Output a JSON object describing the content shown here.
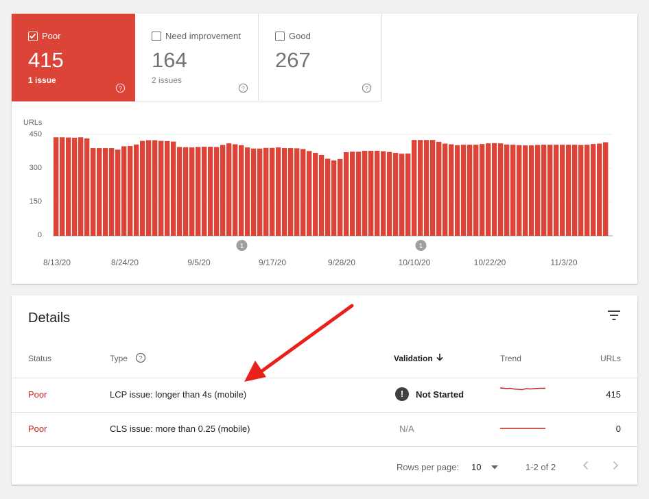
{
  "tiles": [
    {
      "label": "Poor",
      "count": "415",
      "sub": "1 issue",
      "checked": true
    },
    {
      "label": "Need improvement",
      "count": "164",
      "sub": "2 issues",
      "checked": false
    },
    {
      "label": "Good",
      "count": "267",
      "sub": "",
      "checked": false
    }
  ],
  "chart_data": {
    "type": "bar",
    "ylabel": "URLs",
    "yticks": [
      "450",
      "300",
      "150",
      "0"
    ],
    "ylim": [
      0,
      450
    ],
    "xticks": [
      "8/13/20",
      "8/24/20",
      "9/5/20",
      "9/17/20",
      "9/28/20",
      "10/10/20",
      "10/22/20",
      "11/3/20"
    ],
    "color": "#db4437",
    "annotations": [
      {
        "label": "1",
        "after_day": 30
      },
      {
        "label": "1",
        "after_day": 59
      }
    ],
    "values": [
      437,
      437,
      436,
      435,
      437,
      432,
      389,
      389,
      389,
      389,
      382,
      397,
      398,
      405,
      421,
      424,
      424,
      421,
      420,
      418,
      394,
      393,
      392,
      394,
      395,
      395,
      394,
      403,
      410,
      406,
      402,
      392,
      387,
      387,
      390,
      390,
      392,
      389,
      389,
      388,
      385,
      376,
      368,
      359,
      342,
      334,
      341,
      371,
      373,
      373,
      377,
      377,
      377,
      375,
      372,
      368,
      364,
      365,
      425,
      425,
      425,
      425,
      417,
      409,
      406,
      402,
      404,
      404,
      404,
      407,
      410,
      411,
      410,
      405,
      404,
      402,
      401,
      401,
      403,
      404,
      404,
      404,
      404,
      404,
      404,
      403,
      404,
      407,
      409,
      415
    ]
  },
  "details": {
    "title": "Details",
    "headers": {
      "status": "Status",
      "type": "Type",
      "validation": "Validation",
      "trend": "Trend",
      "urls": "URLs"
    },
    "rows": [
      {
        "status": "Poor",
        "type": "LCP issue: longer than 4s (mobile)",
        "validation": "Not Started",
        "validation_icon": "!",
        "urls": "415"
      },
      {
        "status": "Poor",
        "type": "CLS issue: more than 0.25 (mobile)",
        "validation": "N/A",
        "urls": "0"
      }
    ],
    "footer": {
      "rows_per_page_label": "Rows per page:",
      "rows_per_page_value": "10",
      "range": "1-2 of 2"
    }
  },
  "icons": {
    "help": "help-circle-icon",
    "filter": "filter-icon",
    "sort": "arrow-down-icon",
    "arrow": "red-annotation-arrow"
  }
}
